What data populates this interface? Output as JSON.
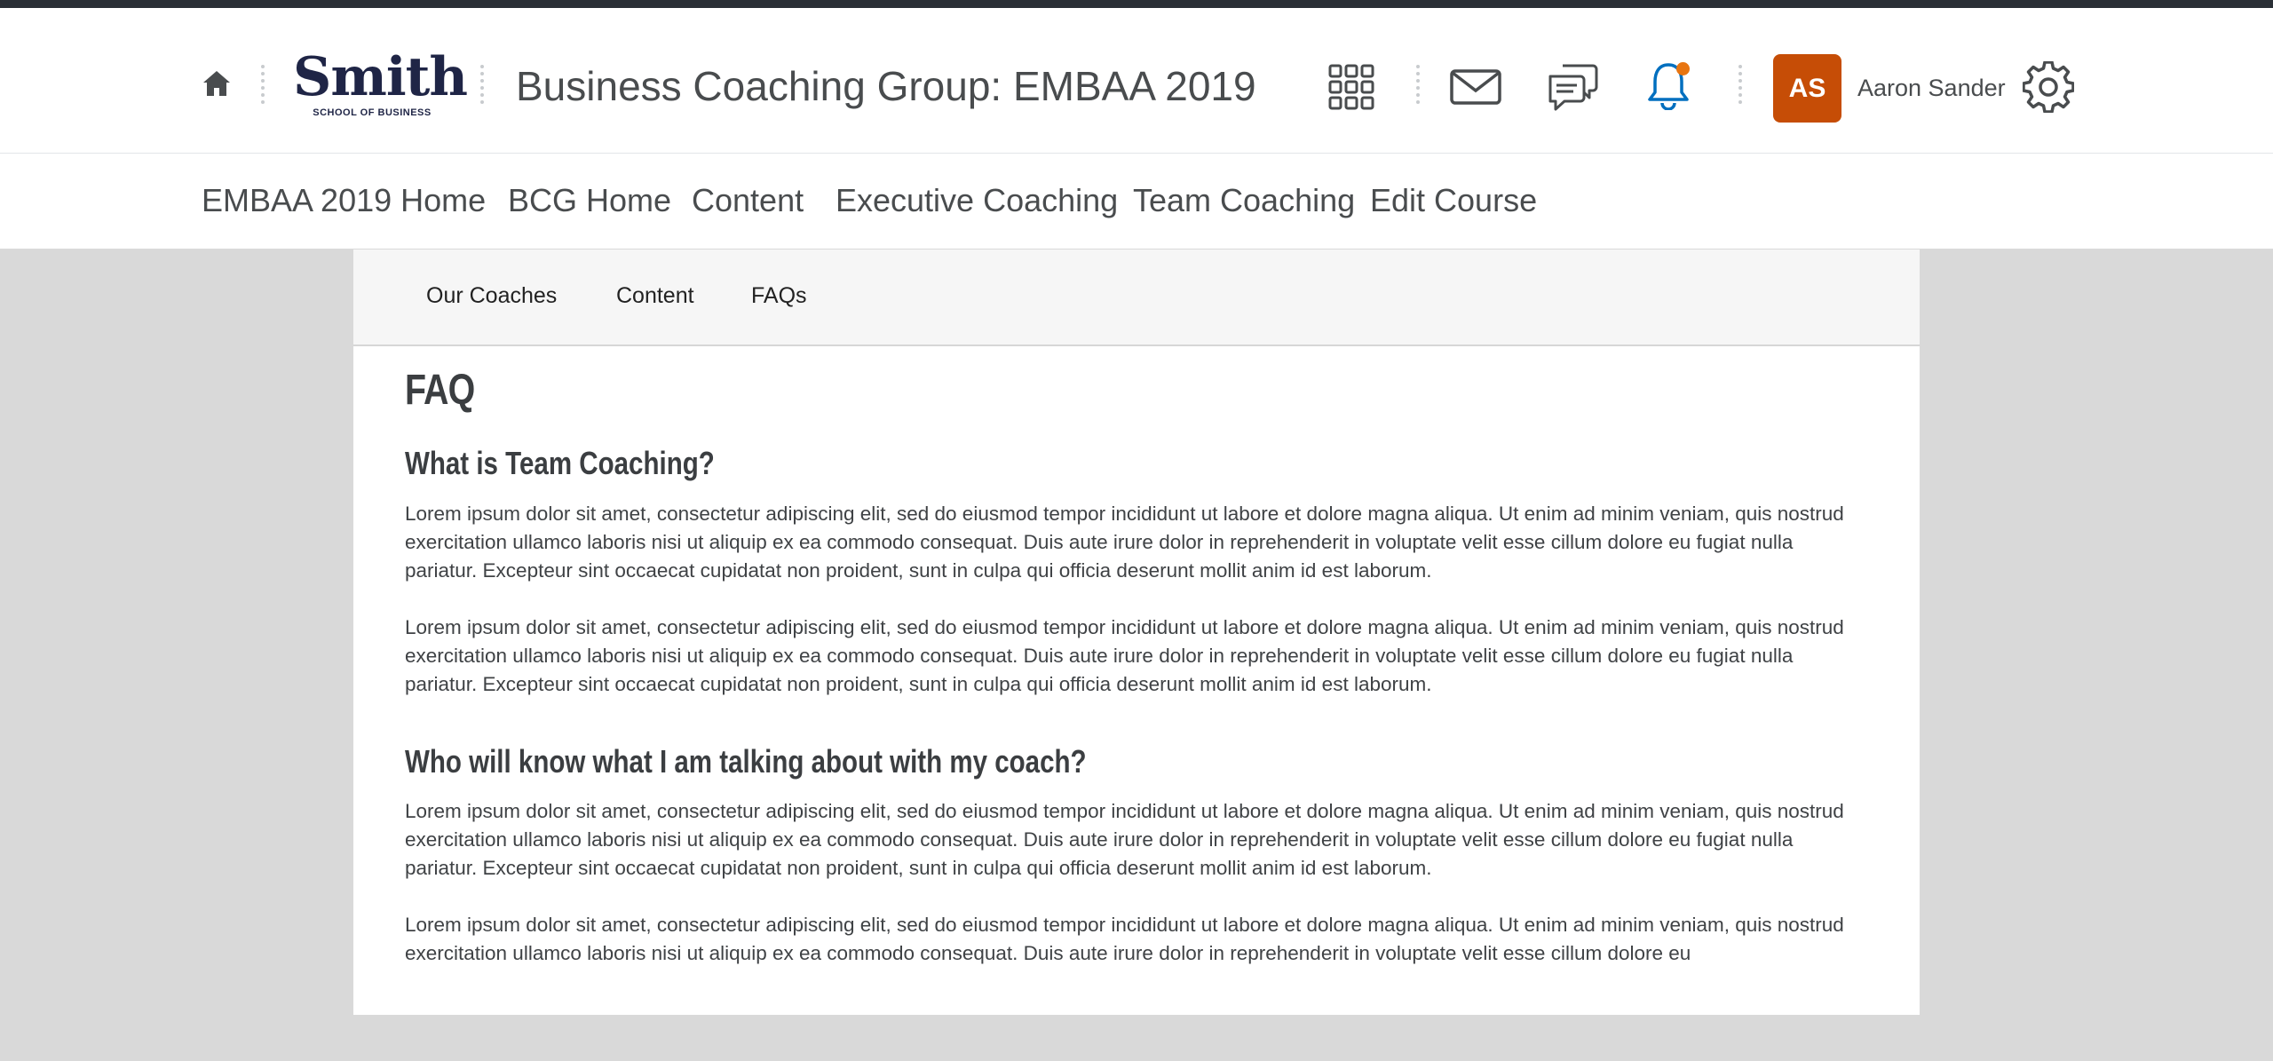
{
  "header": {
    "logo_word": "Smith",
    "logo_sub": "SCHOOL OF BUSINESS",
    "course_title": "Business Coaching Group: EMBAA 2019",
    "user_initials": "AS",
    "user_name": "Aaron Sander",
    "icons": [
      "home-icon",
      "apps-grid-icon",
      "mail-icon",
      "chat-icon",
      "bell-icon",
      "gear-icon"
    ]
  },
  "nav": {
    "items": [
      {
        "label": "EMBAA 2019 Home"
      },
      {
        "label": "BCG Home"
      },
      {
        "label": "Content"
      },
      {
        "label": "Executive Coaching"
      },
      {
        "label": "Team Coaching"
      },
      {
        "label": "Edit Course"
      }
    ]
  },
  "subnav": {
    "items": [
      {
        "label": "Our Coaches"
      },
      {
        "label": "Content"
      },
      {
        "label": "FAQs"
      }
    ]
  },
  "article": {
    "title": "FAQ",
    "sections": [
      {
        "question": "What is Team Coaching?",
        "paragraphs": [
          "Lorem ipsum dolor sit amet, consectetur adipiscing elit, sed do eiusmod tempor incididunt ut labore et dolore magna aliqua. Ut enim ad minim veniam, quis nostrud exercitation ullamco laboris nisi ut aliquip ex ea commodo consequat. Duis aute irure dolor in reprehenderit in voluptate velit esse cillum dolore eu fugiat nulla pariatur. Excepteur sint occaecat cupidatat non proident, sunt in culpa qui officia deserunt mollit anim id est laborum.",
          "Lorem ipsum dolor sit amet, consectetur adipiscing elit, sed do eiusmod tempor incididunt ut labore et dolore magna aliqua. Ut enim ad minim veniam, quis nostrud exercitation ullamco laboris nisi ut aliquip ex ea commodo consequat. Duis aute irure dolor in reprehenderit in voluptate velit esse cillum dolore eu fugiat nulla pariatur. Excepteur sint occaecat cupidatat non proident, sunt in culpa qui officia deserunt mollit anim id est laborum."
        ]
      },
      {
        "question": "Who will know what I am talking about with my coach?",
        "paragraphs": [
          "Lorem ipsum dolor sit amet, consectetur adipiscing elit, sed do eiusmod tempor incididunt ut labore et dolore magna aliqua. Ut enim ad minim veniam, quis nostrud exercitation ullamco laboris nisi ut aliquip ex ea commodo consequat. Duis aute irure dolor in reprehenderit in voluptate velit esse cillum dolore eu fugiat nulla pariatur. Excepteur sint occaecat cupidatat non proident, sunt in culpa qui officia deserunt mollit anim id est laborum.",
          "Lorem ipsum dolor sit amet, consectetur adipiscing elit, sed do eiusmod tempor incididunt ut labore et dolore magna aliqua. Ut enim ad minim veniam, quis nostrud exercitation ullamco laboris nisi ut aliquip ex ea commodo consequat. Duis aute irure dolor in reprehenderit in voluptate velit esse cillum dolore eu"
        ]
      }
    ]
  },
  "colors": {
    "avatar_bg": "#c64d06",
    "notification_dot": "#e87511",
    "active_accent": "#006fbf",
    "logo_navy": "#1f2546",
    "page_bg": "#d9d9d9"
  }
}
